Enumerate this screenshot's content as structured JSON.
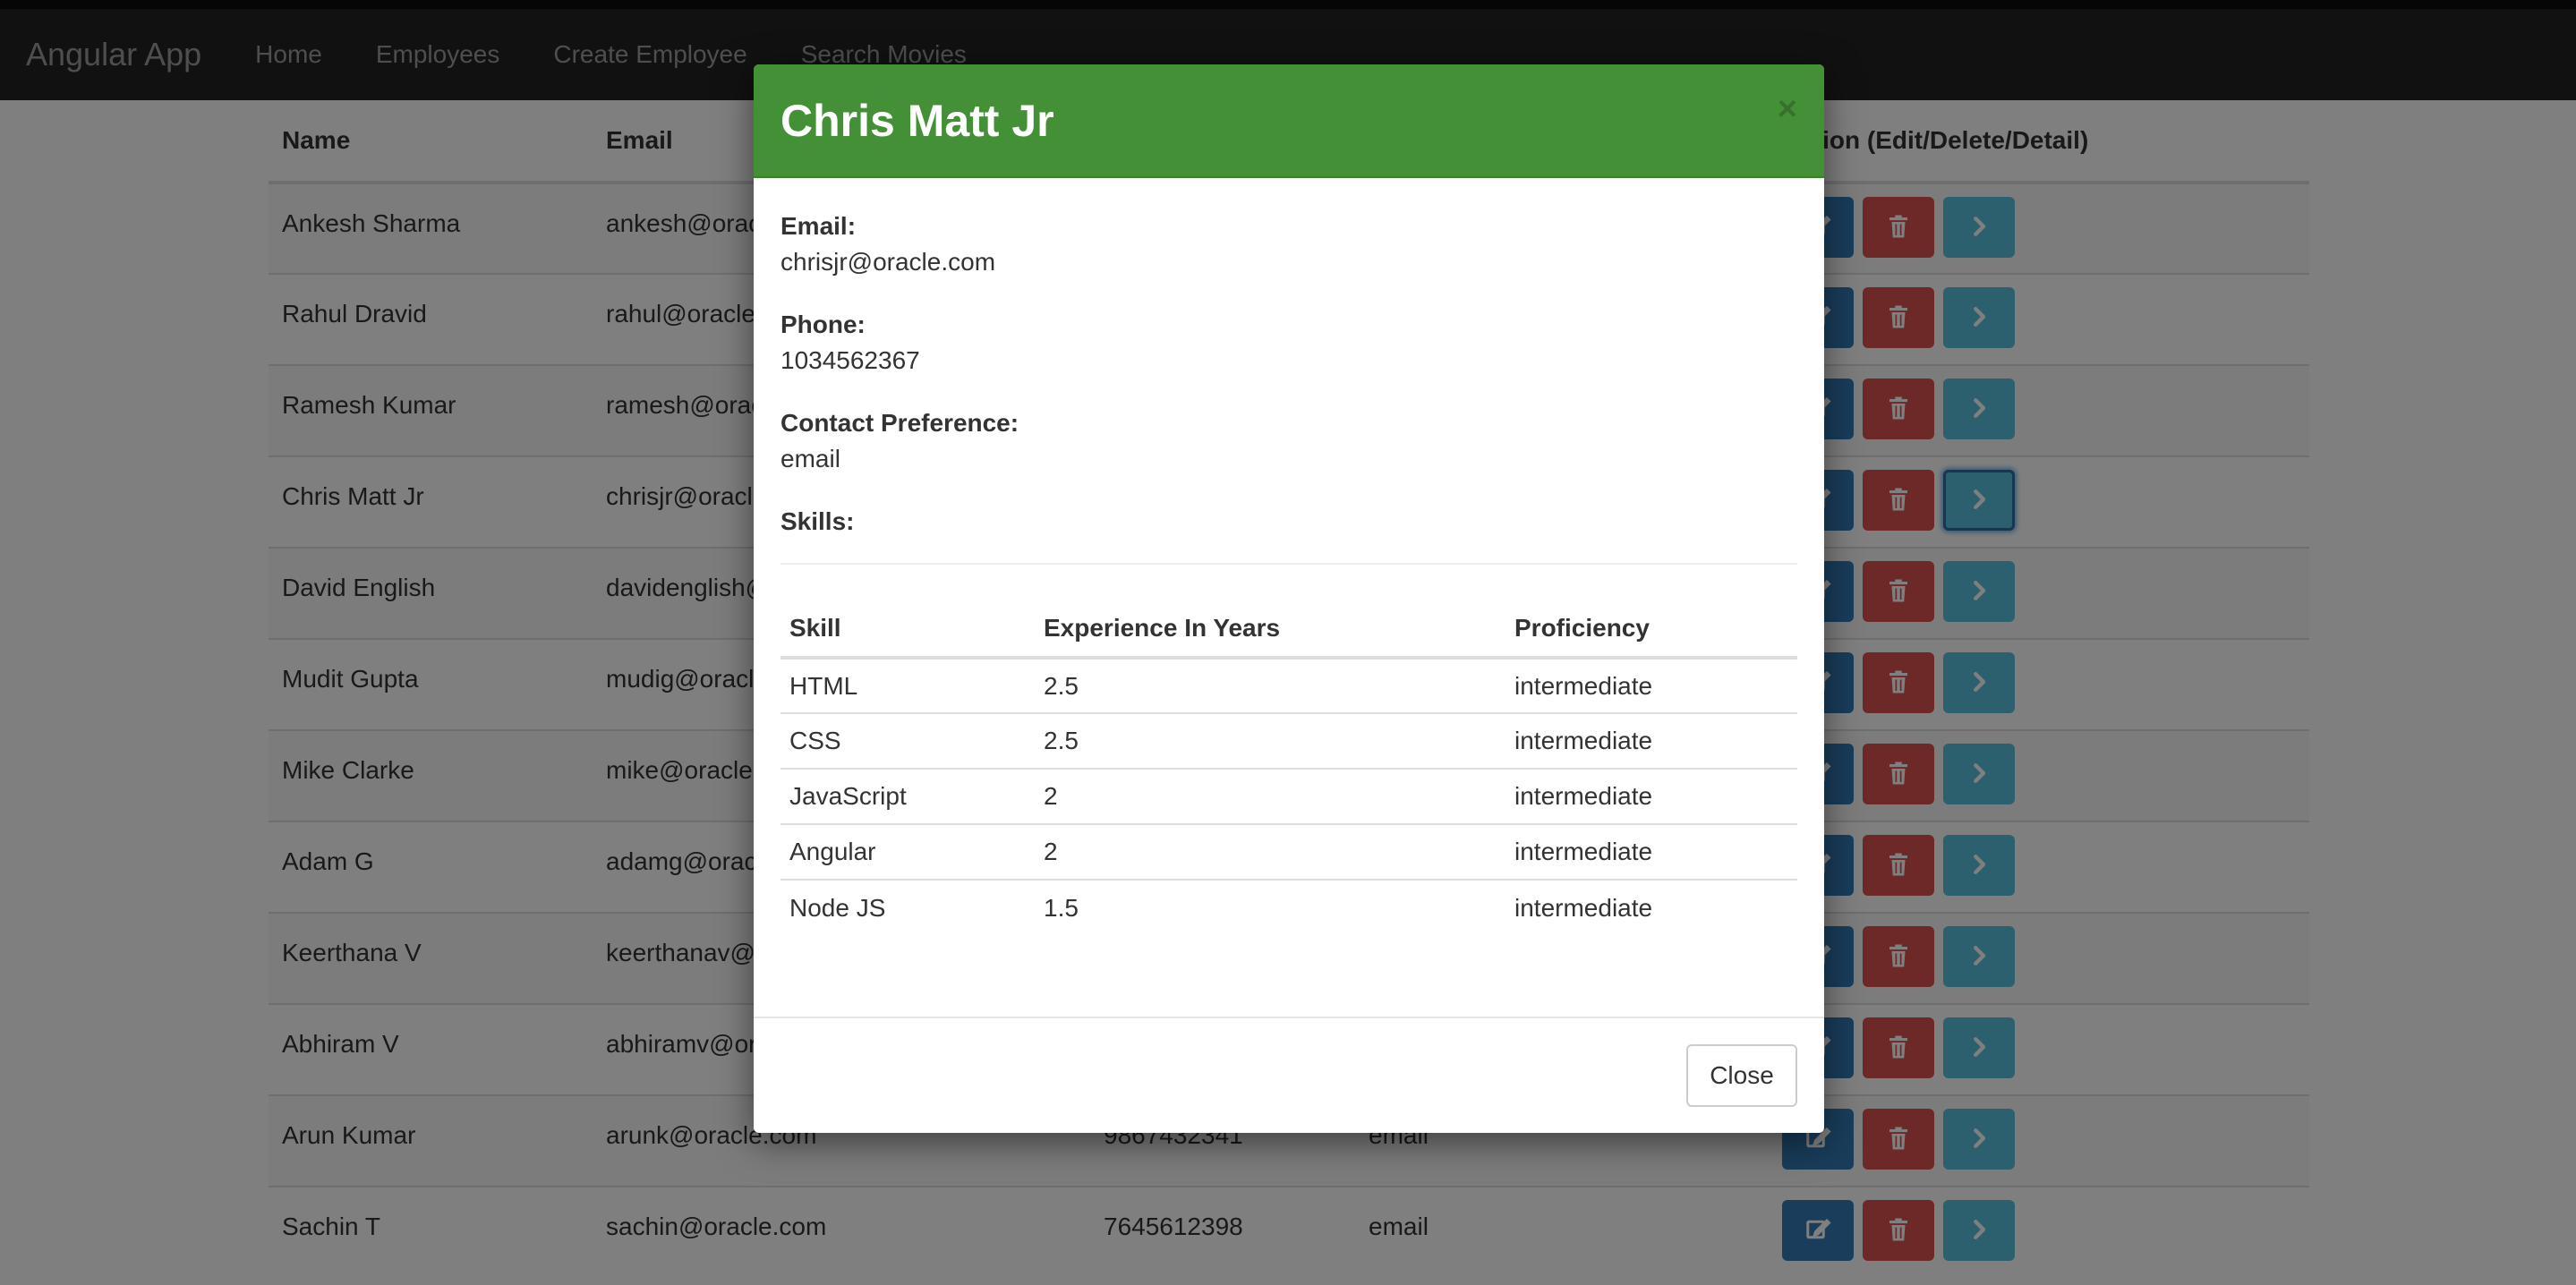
{
  "navbar": {
    "brand": "Angular App",
    "links": [
      "Home",
      "Employees",
      "Create Employee",
      "Search Movies"
    ]
  },
  "table": {
    "headers": {
      "name": "Name",
      "email": "Email",
      "action": "Action (Edit/Delete/Detail)"
    },
    "rows": [
      {
        "name": "Ankesh Sharma",
        "email": "ankesh@oracle.com",
        "phone": "",
        "pref": ""
      },
      {
        "name": "Rahul Dravid",
        "email": "rahul@oracle.com",
        "phone": "",
        "pref": ""
      },
      {
        "name": "Ramesh Kumar",
        "email": "ramesh@oracle.com",
        "phone": "",
        "pref": ""
      },
      {
        "name": "Chris Matt Jr",
        "email": "chrisjr@oracle.com",
        "phone": "",
        "pref": ""
      },
      {
        "name": "David English",
        "email": "davidenglish@oracle.com",
        "phone": "",
        "pref": ""
      },
      {
        "name": "Mudit Gupta",
        "email": "mudig@oracle.com",
        "phone": "",
        "pref": ""
      },
      {
        "name": "Mike Clarke",
        "email": "mike@oracle.com",
        "phone": "",
        "pref": ""
      },
      {
        "name": "Adam G",
        "email": "adamg@oracle.com",
        "phone": "",
        "pref": ""
      },
      {
        "name": "Keerthana V",
        "email": "keerthanav@oracle.com",
        "phone": "",
        "pref": ""
      },
      {
        "name": "Abhiram V",
        "email": "abhiramv@oracle.com",
        "phone": "",
        "pref": ""
      },
      {
        "name": "Arun Kumar",
        "email": "arunk@oracle.com",
        "phone": "9867432341",
        "pref": "email"
      },
      {
        "name": "Sachin T",
        "email": "sachin@oracle.com",
        "phone": "7645612398",
        "pref": "email"
      }
    ]
  },
  "modal": {
    "title": "Chris Matt Jr",
    "close_x": "×",
    "email_label": "Email:",
    "email_value": "chrisjr@oracle.com",
    "phone_label": "Phone:",
    "phone_value": "1034562367",
    "pref_label": "Contact Preference:",
    "pref_value": "email",
    "skills_label": "Skills:",
    "skills_headers": [
      "Skill",
      "Experience In Years",
      "Proficiency"
    ],
    "skills": [
      {
        "skill": "HTML",
        "years": "2.5",
        "proficiency": "intermediate"
      },
      {
        "skill": "CSS",
        "years": "2.5",
        "proficiency": "intermediate"
      },
      {
        "skill": "JavaScript",
        "years": "2",
        "proficiency": "intermediate"
      },
      {
        "skill": "Angular",
        "years": "2",
        "proficiency": "intermediate"
      },
      {
        "skill": "Node JS",
        "years": "1.5",
        "proficiency": "intermediate"
      }
    ],
    "close_button": "Close"
  },
  "colors": {
    "navbar": "#222222",
    "modal_header": "#449037",
    "edit": "#337ab7",
    "delete": "#d9534f",
    "detail": "#5bc0de"
  },
  "icons": {
    "edit": "edit-icon",
    "delete": "trash-icon",
    "detail": "chevron-right-icon"
  }
}
